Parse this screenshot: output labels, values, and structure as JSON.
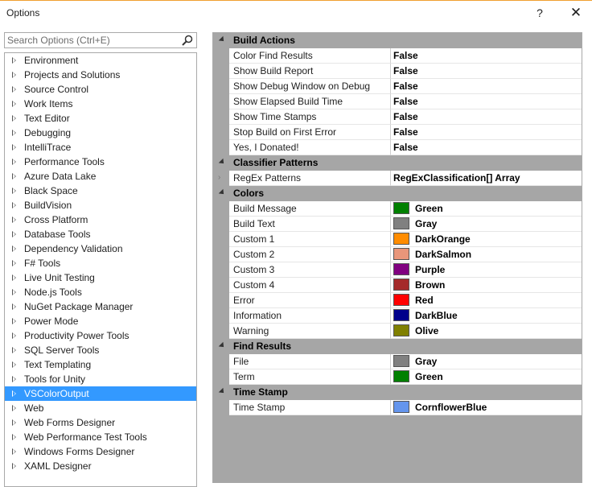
{
  "window": {
    "title": "Options",
    "help_label": "?",
    "close_label": "✕"
  },
  "search": {
    "placeholder": "Search Options (Ctrl+E)",
    "value": ""
  },
  "tree": {
    "items": [
      {
        "label": "Environment"
      },
      {
        "label": "Projects and Solutions"
      },
      {
        "label": "Source Control"
      },
      {
        "label": "Work Items"
      },
      {
        "label": "Text Editor"
      },
      {
        "label": "Debugging"
      },
      {
        "label": "IntelliTrace"
      },
      {
        "label": "Performance Tools"
      },
      {
        "label": "Azure Data Lake"
      },
      {
        "label": "Black Space"
      },
      {
        "label": "BuildVision"
      },
      {
        "label": "Cross Platform"
      },
      {
        "label": "Database Tools"
      },
      {
        "label": "Dependency Validation"
      },
      {
        "label": "F# Tools"
      },
      {
        "label": "Live Unit Testing"
      },
      {
        "label": "Node.js Tools"
      },
      {
        "label": "NuGet Package Manager"
      },
      {
        "label": "Power Mode"
      },
      {
        "label": "Productivity Power Tools"
      },
      {
        "label": "SQL Server Tools"
      },
      {
        "label": "Text Templating"
      },
      {
        "label": "Tools for Unity"
      },
      {
        "label": "VSColorOutput",
        "selected": true
      },
      {
        "label": "Web"
      },
      {
        "label": "Web Forms Designer"
      },
      {
        "label": "Web Performance Test Tools"
      },
      {
        "label": "Windows Forms Designer"
      },
      {
        "label": "XAML Designer"
      }
    ]
  },
  "grid": {
    "categories": [
      {
        "name": "Build Actions",
        "rows": [
          {
            "name": "Color Find Results",
            "value": "False",
            "selected": true
          },
          {
            "name": "Show Build Report",
            "value": "False"
          },
          {
            "name": "Show Debug Window on Debug",
            "value": "False"
          },
          {
            "name": "Show Elapsed Build Time",
            "value": "False"
          },
          {
            "name": "Show Time Stamps",
            "value": "False"
          },
          {
            "name": "Stop Build on First Error",
            "value": "False"
          },
          {
            "name": "Yes, I Donated!",
            "value": "False"
          }
        ]
      },
      {
        "name": "Classifier Patterns",
        "rows": [
          {
            "name": "RegEx Patterns",
            "value": "RegExClassification[] Array",
            "expandable": true
          }
        ]
      },
      {
        "name": "Colors",
        "rows": [
          {
            "name": "Build Message",
            "value": "Green",
            "color": "#008000"
          },
          {
            "name": "Build Text",
            "value": "Gray",
            "color": "#808080"
          },
          {
            "name": "Custom 1",
            "value": "DarkOrange",
            "color": "#ff8c00"
          },
          {
            "name": "Custom 2",
            "value": "DarkSalmon",
            "color": "#e9967a"
          },
          {
            "name": "Custom 3",
            "value": "Purple",
            "color": "#800080"
          },
          {
            "name": "Custom 4",
            "value": "Brown",
            "color": "#a52a2a"
          },
          {
            "name": "Error",
            "value": "Red",
            "color": "#ff0000"
          },
          {
            "name": "Information",
            "value": "DarkBlue",
            "color": "#00008b"
          },
          {
            "name": "Warning",
            "value": "Olive",
            "color": "#808000"
          }
        ]
      },
      {
        "name": "Find Results",
        "rows": [
          {
            "name": "File",
            "value": "Gray",
            "color": "#808080"
          },
          {
            "name": "Term",
            "value": "Green",
            "color": "#008000"
          }
        ]
      },
      {
        "name": "Time Stamp",
        "rows": [
          {
            "name": "Time Stamp",
            "value": "CornflowerBlue",
            "color": "#6495ed"
          }
        ]
      }
    ]
  }
}
